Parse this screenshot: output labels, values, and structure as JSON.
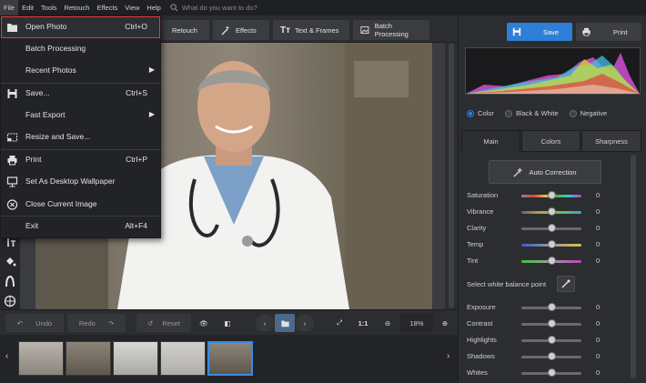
{
  "menubar": {
    "items": [
      "File",
      "Edit",
      "Tools",
      "Retouch",
      "Effects",
      "View",
      "Help"
    ],
    "search_placeholder": "What do you want to do?"
  },
  "toolbar": {
    "tabs": [
      "Retouch",
      "Effects",
      "Text & Frames",
      "Batch Processing"
    ]
  },
  "file_menu": {
    "items": [
      {
        "label": "Open Photo",
        "shortcut": "Ctrl+O",
        "icon": "folder-icon"
      },
      {
        "label": "Batch Processing",
        "shortcut": "",
        "icon": ""
      },
      {
        "label": "Recent Photos",
        "shortcut": "",
        "icon": ""
      },
      {
        "label": "Save...",
        "shortcut": "Ctrl+S",
        "icon": "save-icon"
      },
      {
        "label": "Fast Export",
        "shortcut": "",
        "icon": ""
      },
      {
        "label": "Resize and Save...",
        "shortcut": "",
        "icon": "resize-icon"
      },
      {
        "label": "Print",
        "shortcut": "Ctrl+P",
        "icon": "print-icon"
      },
      {
        "label": "Set As Desktop Wallpaper",
        "shortcut": "",
        "icon": "monitor-icon"
      },
      {
        "label": "Close Current Image",
        "shortcut": "",
        "icon": "close-circle-icon"
      },
      {
        "label": "Exit",
        "shortcut": "Alt+F4",
        "icon": ""
      }
    ]
  },
  "bottom": {
    "undo": "Undo",
    "redo": "Redo",
    "reset": "Reset",
    "one_to_one": "1:1",
    "zoom": "18%"
  },
  "right": {
    "save": "Save",
    "print": "Print",
    "modes": [
      "Color",
      "Black & White",
      "Negative"
    ],
    "tabs": [
      "Main",
      "Colors",
      "Sharpness"
    ],
    "auto_correction": "Auto Correction",
    "white_balance": "Select white balance point",
    "sliders1": [
      {
        "name": "Saturation",
        "value": "0"
      },
      {
        "name": "Vibrance",
        "value": "0"
      },
      {
        "name": "Clarity",
        "value": "0"
      },
      {
        "name": "Temp",
        "value": "0"
      },
      {
        "name": "Tint",
        "value": "0"
      }
    ],
    "sliders2": [
      {
        "name": "Exposure",
        "value": "0"
      },
      {
        "name": "Contrast",
        "value": "0"
      },
      {
        "name": "Highlights",
        "value": "0"
      },
      {
        "name": "Shadows",
        "value": "0"
      },
      {
        "name": "Whites",
        "value": "0"
      }
    ]
  },
  "colors": {
    "accent": "#2f7fd8",
    "highlight": "#e53b3b"
  }
}
